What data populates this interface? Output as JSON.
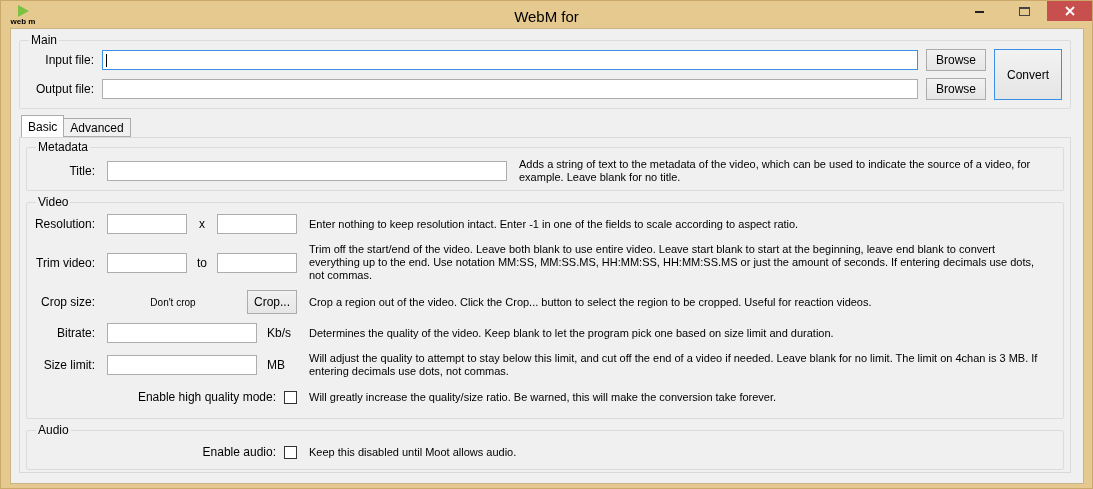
{
  "window": {
    "title": "WebM for",
    "icon_label": "web m"
  },
  "main": {
    "legend": "Main",
    "files": [
      {
        "label": "Input file:",
        "focused": true,
        "button": "Browse"
      },
      {
        "label": "Output file:",
        "focused": false,
        "button": "Browse"
      }
    ],
    "convert": "Convert"
  },
  "tabs": [
    {
      "label": "Basic",
      "selected": true
    },
    {
      "label": "Advanced",
      "selected": false
    }
  ],
  "groups": [
    {
      "legend": "Metadata",
      "rows": [
        {
          "kind": "wide",
          "label": "Title:",
          "description": "Adds a string of text to the metadata of the video, which can be used to indicate the source of a video, for example. Leave blank for no title."
        }
      ]
    },
    {
      "legend": "Video",
      "rows": [
        {
          "kind": "pair",
          "label": "Resolution:",
          "separator": "x",
          "description": "Enter nothing to keep resolution intact. Enter -1 in one of the fields to scale according to aspect ratio."
        },
        {
          "kind": "pair",
          "label": "Trim video:",
          "separator": "to",
          "description": "Trim off the start/end of the video. Leave both blank to use entire video. Leave start blank to start at the beginning, leave end blank to convert everything up to the end. Use notation MM:SS, MM:SS.MS, HH:MM:SS, HH:MM:SS.MS or just the amount of seconds. If entering decimals use dots, not commas."
        },
        {
          "kind": "crop",
          "label": "Crop size:",
          "value": "Don't crop",
          "button": "Crop...",
          "description": "Crop a region out of the video. Click the Crop... button to select the region to be cropped. Useful for reaction videos."
        },
        {
          "kind": "unit",
          "label": "Bitrate:",
          "unit": "Kb/s",
          "description": "Determines the quality of the video. Keep blank to let the program pick one based on size limit and duration."
        },
        {
          "kind": "unit",
          "label": "Size limit:",
          "unit": "MB",
          "description": "Will adjust the quality to attempt to stay below this limit, and cut off the end of a video if needed. Leave blank for no limit. The limit on 4chan is 3 MB. If entering decimals use dots, not commas."
        },
        {
          "kind": "check",
          "label": "Enable high quality mode:",
          "checked": false,
          "description": "Will greatly increase the quality/size ratio. Be warned, this will make the conversion take forever."
        }
      ]
    },
    {
      "legend": "Audio",
      "rows": [
        {
          "kind": "check",
          "label": "Enable audio:",
          "checked": false,
          "description": "Keep this disabled until Moot allows audio."
        }
      ]
    }
  ]
}
